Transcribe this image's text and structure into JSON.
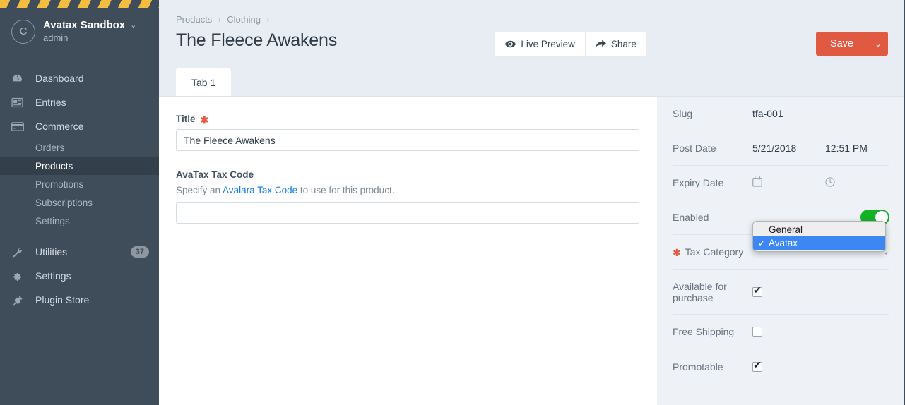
{
  "sidebar": {
    "account": {
      "initial": "C",
      "name": "Avatax Sandbox",
      "caret": "⌄",
      "user": "admin"
    },
    "items": [
      {
        "label": "Dashboard",
        "icon": "gauge-icon",
        "type": "top"
      },
      {
        "label": "Entries",
        "icon": "entries-icon",
        "type": "top"
      },
      {
        "label": "Commerce",
        "icon": "credit-card-icon",
        "type": "top"
      },
      {
        "label": "Orders",
        "type": "sub"
      },
      {
        "label": "Products",
        "type": "sub",
        "active": true
      },
      {
        "label": "Promotions",
        "type": "sub"
      },
      {
        "label": "Subscriptions",
        "type": "sub"
      },
      {
        "label": "Settings",
        "type": "sub"
      },
      {
        "label": "Utilities",
        "icon": "wrench-icon",
        "type": "top",
        "badge": "37"
      },
      {
        "label": "Settings",
        "icon": "gear-icon",
        "type": "top"
      },
      {
        "label": "Plugin Store",
        "icon": "plug-icon",
        "type": "top"
      }
    ]
  },
  "header": {
    "breadcrumb": [
      "Products",
      "Clothing"
    ],
    "separator": "›",
    "title": "The Fleece Awakens",
    "live_preview_label": "Live Preview",
    "share_label": "Share",
    "save_label": "Save",
    "save_caret": "⌄"
  },
  "tabs": [
    {
      "label": "Tab 1",
      "active": true
    }
  ],
  "form": {
    "title_field": {
      "label": "Title",
      "required_marker": "✱",
      "value": "The Fleece Awakens",
      "placeholder": ""
    },
    "avatax_field": {
      "label": "AvaTax Tax Code",
      "instructions_before": "Specify an ",
      "instructions_link": "Avalara Tax Code",
      "instructions_after": " to use for this product.",
      "value": "",
      "placeholder": ""
    }
  },
  "meta": {
    "slug": {
      "label": "Slug",
      "value": "tfa-001"
    },
    "post_date": {
      "label": "Post Date",
      "date": "5/21/2018",
      "time": "12:51 PM"
    },
    "expiry_date": {
      "label": "Expiry Date",
      "date": "",
      "time": "",
      "date_icon": "calendar-icon",
      "time_icon": "clock-icon"
    },
    "enabled": {
      "label": "Enabled",
      "state": "on"
    },
    "tax_category": {
      "label": "Tax Category",
      "required_marker": "✱",
      "selected": "Avatax",
      "chevron": "⌄",
      "options": [
        {
          "label": "General",
          "selected": false,
          "check": ""
        },
        {
          "label": "Avatax",
          "selected": true,
          "check": "✓"
        }
      ]
    },
    "available_for_purchase": {
      "label": "Available for purchase",
      "checked": true
    },
    "free_shipping": {
      "label": "Free Shipping",
      "checked": false
    },
    "promotable": {
      "label": "Promotable",
      "checked": true
    }
  },
  "colors": {
    "sidebar_bg": "#3f4d5a",
    "accent_save": "#e05a42",
    "link_blue": "#0d78f2",
    "toggle_green": "#12b326",
    "dropdown_highlight": "#3b88f5",
    "stripe_yellow": "#f5bd3f"
  }
}
